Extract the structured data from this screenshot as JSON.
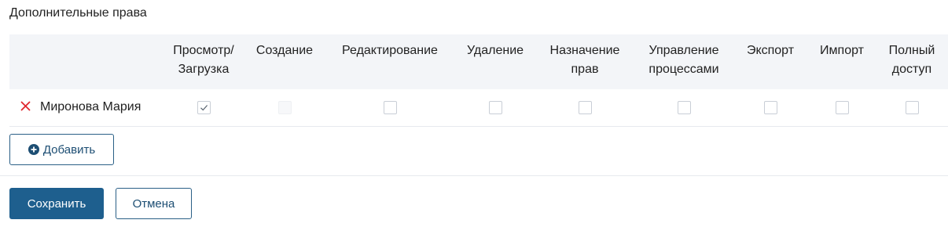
{
  "section": {
    "title": "Дополнительные права"
  },
  "table": {
    "columns": [
      {
        "line1": "Просмотр/",
        "line2": "Загрузка"
      },
      {
        "line1": "Создание",
        "line2": ""
      },
      {
        "line1": "Редактирование",
        "line2": ""
      },
      {
        "line1": "Удаление",
        "line2": ""
      },
      {
        "line1": "Назначение",
        "line2": "прав"
      },
      {
        "line1": "Управление",
        "line2": "процессами"
      },
      {
        "line1": "Экспорт",
        "line2": ""
      },
      {
        "line1": "Импорт",
        "line2": ""
      },
      {
        "line1": "Полный",
        "line2": "доступ"
      }
    ],
    "rows": [
      {
        "user": "Миронова Мария",
        "checked": [
          true,
          false,
          false,
          false,
          false,
          false,
          false,
          false,
          false
        ],
        "disabled": [
          false,
          true,
          false,
          false,
          false,
          false,
          false,
          false,
          false
        ]
      }
    ]
  },
  "actions": {
    "add_label": "Добавить",
    "save_label": "Сохранить",
    "cancel_label": "Отмена"
  },
  "colors": {
    "primary": "#1e5f8e",
    "remove_icon": "#e0262d",
    "header_bg": "#f3f5f8"
  }
}
